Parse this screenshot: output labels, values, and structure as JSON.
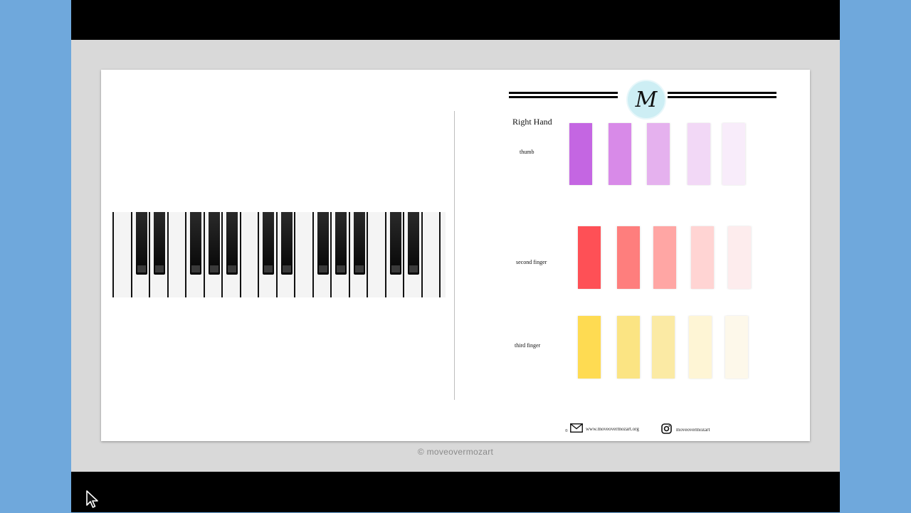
{
  "page": {
    "title": "Right Hand",
    "logo_letter": "M",
    "rows": [
      {
        "label": "thumb",
        "colors": [
          "#c466e2",
          "#d88ae8",
          "#e5b1ee",
          "#f2d8f6",
          "#f8ecfa"
        ]
      },
      {
        "label": "second finger",
        "colors": [
          "#fe5056",
          "#fe7e7d",
          "#ffa6a4",
          "#ffd4d3",
          "#fdeced"
        ]
      },
      {
        "label": "third finger",
        "colors": [
          "#fedb52",
          "#fbe483",
          "#fbeaa4",
          "#fef5d5",
          "#fdf8ea"
        ]
      }
    ],
    "footer": {
      "copyright": "©",
      "website": "www.moveovermozart.org",
      "instagram": "moveovermozart"
    }
  },
  "caption": "©  moveovermozart",
  "colors": {
    "outer_background": "#6fa8dc",
    "viewer_background": "#d9d9d9"
  },
  "icons": [
    "mail-icon",
    "instagram-icon",
    "mouse-cursor-icon"
  ]
}
